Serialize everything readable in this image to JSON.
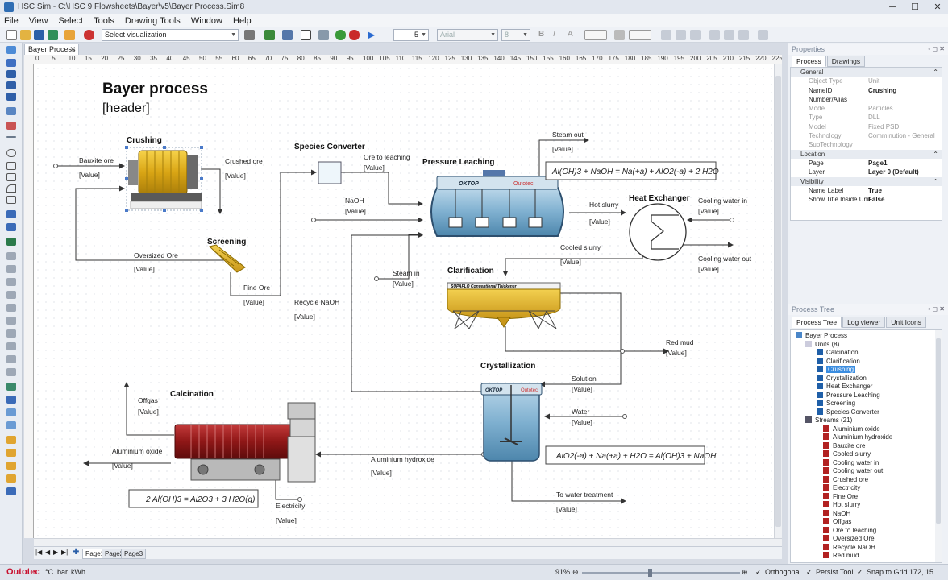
{
  "window": {
    "title": "HSC Sim - C:\\HSC 9 Flowsheets\\Bayer\\v5\\Bayer Process.Sim8",
    "minimize": "─",
    "maximize": "☐",
    "close": "✕"
  },
  "menu": [
    "File",
    "View",
    "Select",
    "Tools",
    "Drawing Tools",
    "Window",
    "Help"
  ],
  "toolbar": {
    "visualization": "Select visualization",
    "zoom_value": "5",
    "font": "Arial",
    "font_size": "8"
  },
  "doc_tab": "Bayer Process",
  "ruler": [
    "0",
    "5",
    "10",
    "15",
    "20",
    "25",
    "30",
    "35",
    "40",
    "45",
    "50",
    "55",
    "60",
    "65",
    "70",
    "75",
    "80",
    "85",
    "90",
    "95",
    "100",
    "105",
    "110",
    "115",
    "120",
    "125",
    "130",
    "135",
    "140",
    "145",
    "150",
    "155",
    "160",
    "165",
    "170",
    "175",
    "180",
    "185",
    "190",
    "195",
    "200",
    "205",
    "210",
    "215",
    "220",
    "225",
    "230"
  ],
  "flowsheet": {
    "title": "Bayer process",
    "header": "[header]",
    "units": {
      "crushing": "Crushing",
      "screening": "Screening",
      "species_converter": "Species Converter",
      "pressure_leaching": "Pressure Leaching",
      "heat_exchanger": "Heat Exchanger",
      "clarification": "Clarification",
      "crystallization": "Crystallization",
      "calcination": "Calcination"
    },
    "streams": {
      "bauxite_ore": "Bauxite ore",
      "crushed_ore": "Crushed ore",
      "oversized_ore": "Oversized Ore",
      "fine_ore": "Fine Ore",
      "ore_to_leaching": "Ore to leaching",
      "naoh": "NaOH",
      "steam_out": "Steam out",
      "hot_slurry": "Hot slurry",
      "cooling_water_in": "Cooling water in",
      "cooling_water_out": "Cooling water out",
      "cooled_slurry": "Cooled slurry",
      "steam_in": "Steam in",
      "recycle_naoh": "Recycle NaOH",
      "red_mud": "Red mud",
      "solution": "Solution",
      "water": "Water",
      "offgas": "Offgas",
      "aluminium_hydroxide": "Aluminium hydroxide",
      "aluminium_oxide": "Aluminium oxide",
      "electricity": "Electricity",
      "to_water_treatment": "To water treatment"
    },
    "value_placeholder": "[Value]",
    "reactions": {
      "leaching": "Al(OH)3 + NaOH = Na(+a) + AlO2(-a) + 2 H2O",
      "crystallization": "AlO2(-a) + Na(+a) + H2O = Al(OH)3 + NaOH",
      "calcination": "2 Al(OH)3 = Al2O3 + 3 H2O(g)"
    },
    "equipment_labels": {
      "oktop": "OKTOP",
      "outotec": "Outotec",
      "supaflo": "SUPAFLO Conventional Thickener"
    }
  },
  "pages": [
    "Page1",
    "Page2",
    "Page3"
  ],
  "status": {
    "brand": "Outotec",
    "units": [
      "°C",
      "bar",
      "kWh"
    ],
    "zoom": "91%",
    "orthogonal": "Orthogonal",
    "persist_tool": "Persist Tool",
    "snap_to_grid": "Snap to Grid",
    "coords": "172, 15"
  },
  "properties": {
    "panel_title": "Properties",
    "tabs": [
      "Process",
      "Drawings"
    ],
    "rows": [
      {
        "type": "cat",
        "k": "General"
      },
      {
        "type": "dim",
        "k": "Object Type",
        "v": "Unit"
      },
      {
        "type": "norm",
        "k": "NameID",
        "v": "Crushing"
      },
      {
        "type": "norm",
        "k": "Number/Alias",
        "v": ""
      },
      {
        "type": "dim",
        "k": "Mode",
        "v": "Particles"
      },
      {
        "type": "dim",
        "k": "Type",
        "v": "DLL"
      },
      {
        "type": "dim",
        "k": "Model",
        "v": "Fixed PSD"
      },
      {
        "type": "dim",
        "k": "Technology",
        "v": "Comminution - General"
      },
      {
        "type": "dim",
        "k": "SubTechnology",
        "v": ""
      },
      {
        "type": "cat",
        "k": "Location"
      },
      {
        "type": "norm",
        "k": "Page",
        "v": "Page1"
      },
      {
        "type": "norm",
        "k": "Layer",
        "v": "Layer 0 (Default)"
      },
      {
        "type": "cat",
        "k": "Visibility"
      },
      {
        "type": "norm",
        "k": "Name Label",
        "v": "True"
      },
      {
        "type": "norm",
        "k": "Show Title Inside Unit",
        "v": "False"
      }
    ]
  },
  "process_tree": {
    "panel_title": "Process Tree",
    "tabs": [
      "Process Tree",
      "Log viewer",
      "Unit Icons"
    ],
    "root": "Bayer Process",
    "units_label": "Units (8)",
    "units": [
      "Calcination",
      "Clarification",
      "Crushing",
      "Crystallization",
      "Heat Exchanger",
      "Pressure Leaching",
      "Screening",
      "Species Converter"
    ],
    "selected": "Crushing",
    "streams_label": "Streams (21)",
    "streams": [
      "Aluminium oxide",
      "Aluminium hydroxide",
      "Bauxite ore",
      "Cooled slurry",
      "Cooling water in",
      "Cooling water out",
      "Crushed ore",
      "Electricity",
      "Fine Ore",
      "Hot slurry",
      "NaOH",
      "Offgas",
      "Ore to leaching",
      "Oversized Ore",
      "Recycle NaOH",
      "Red mud"
    ]
  }
}
